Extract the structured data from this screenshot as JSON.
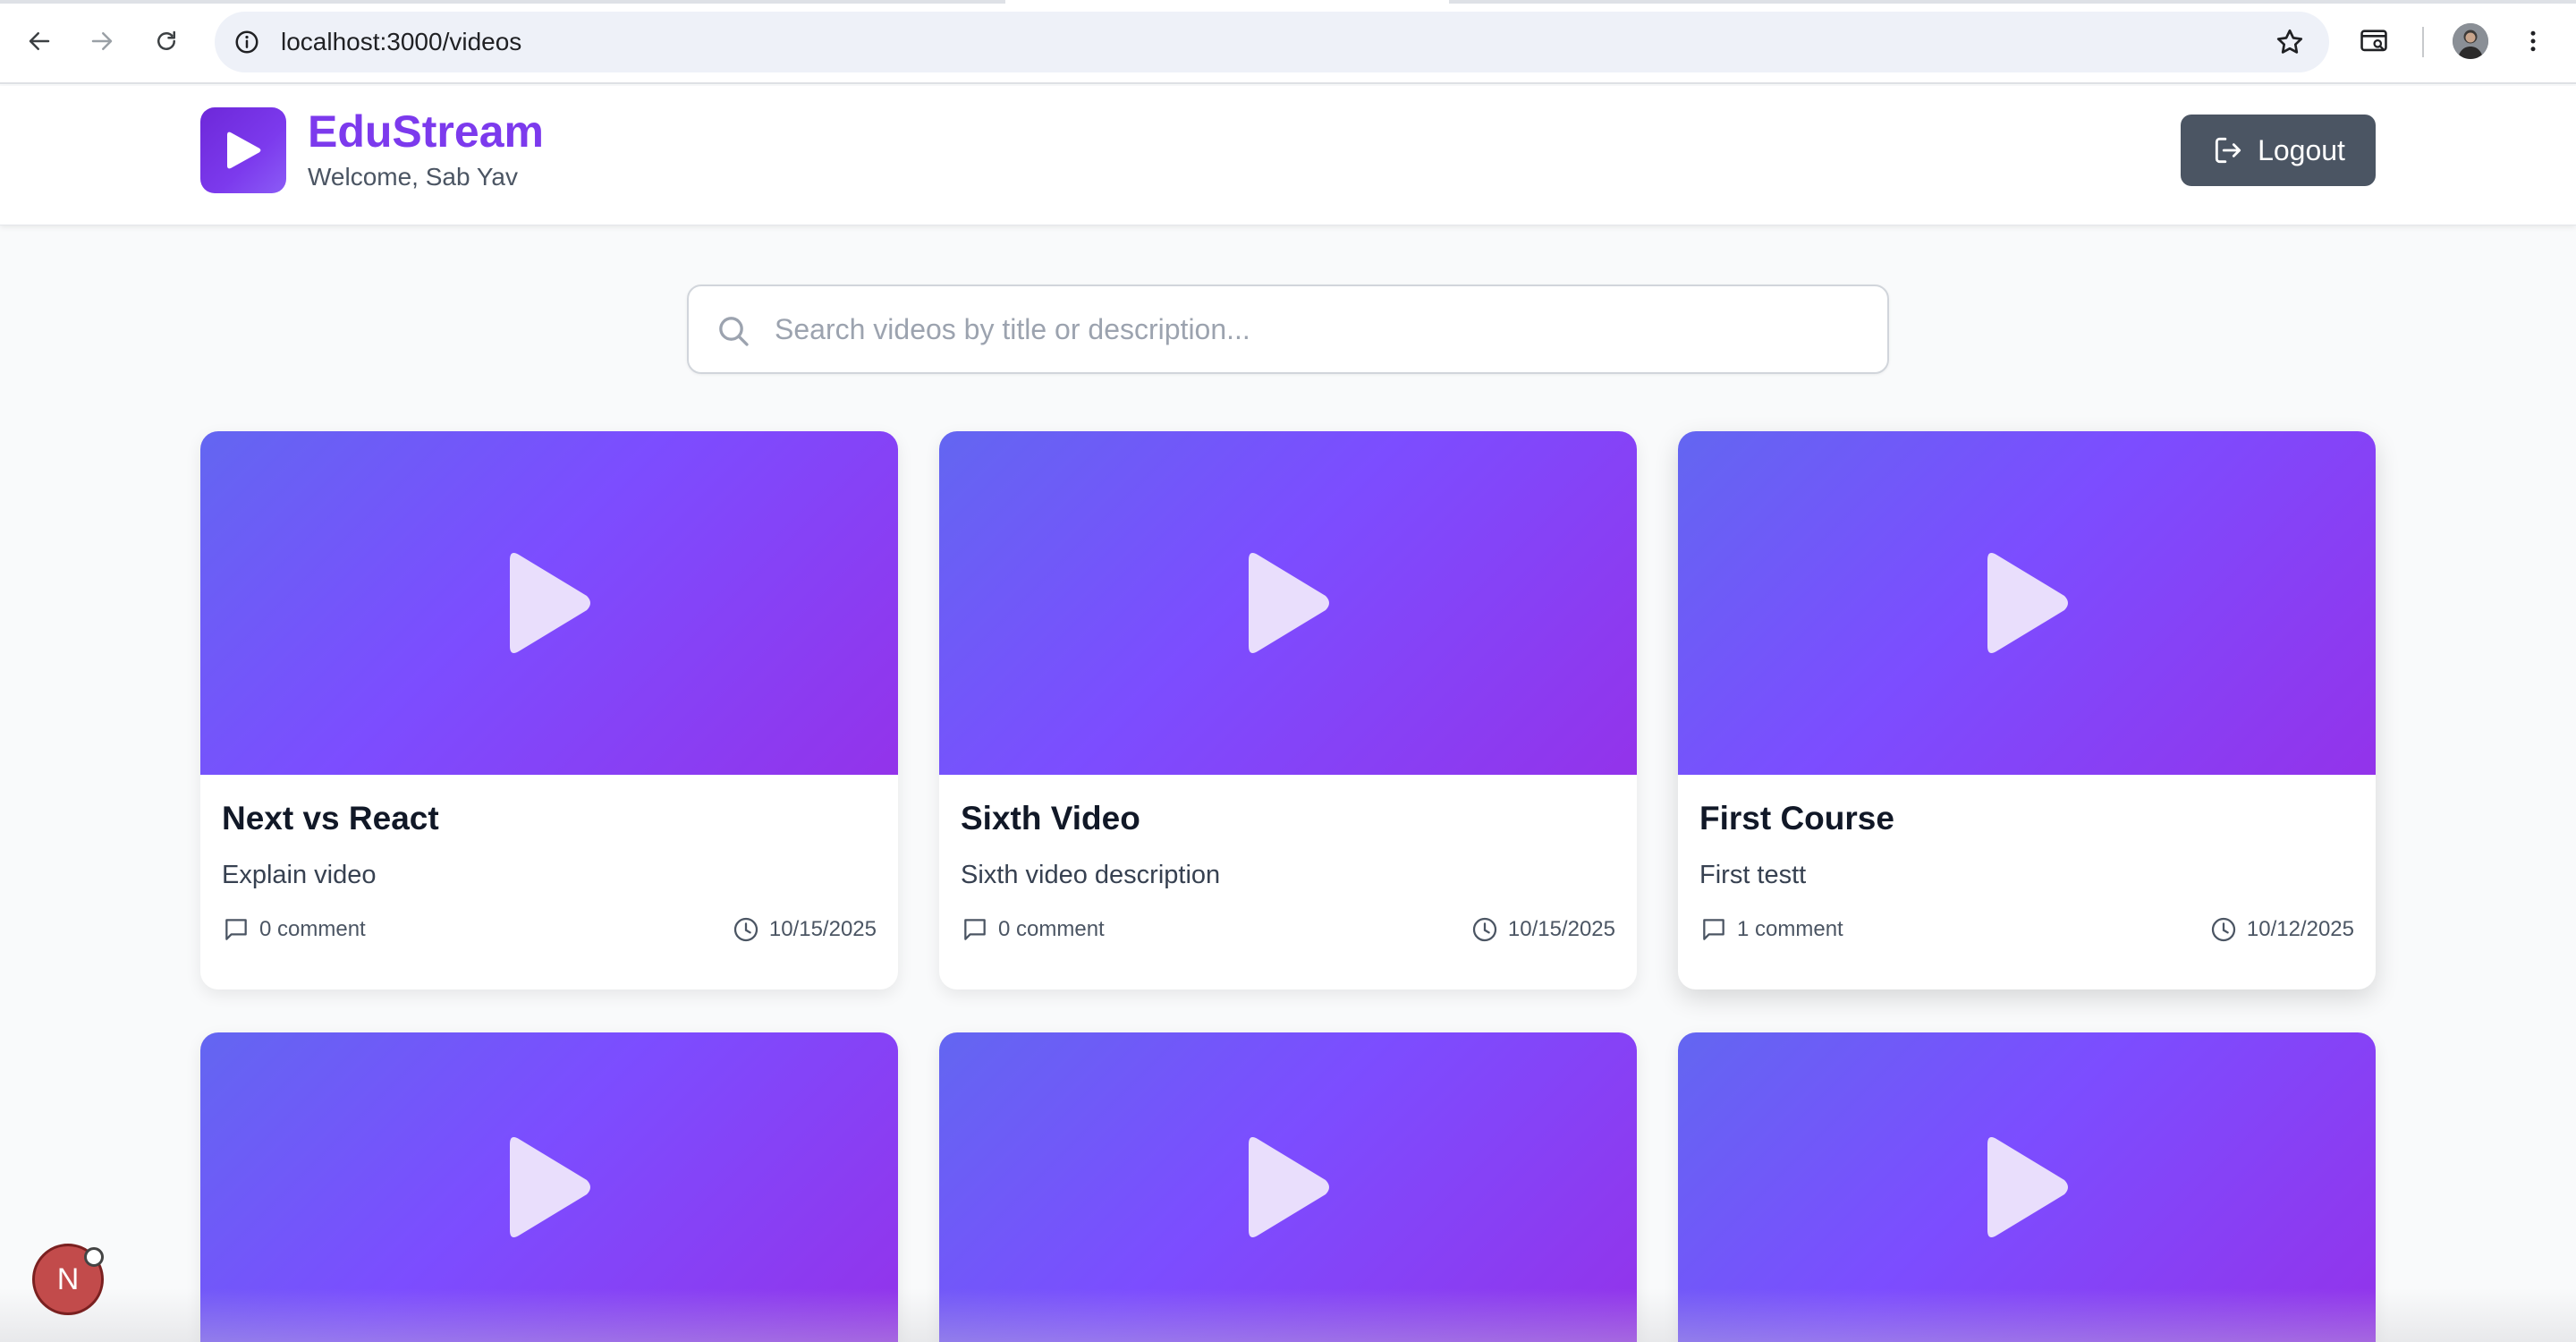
{
  "browser": {
    "url": "localhost:3000/videos",
    "icons": [
      "back-arrow-icon",
      "forward-arrow-icon",
      "reload-icon",
      "site-info-icon",
      "bookmark-star-icon",
      "tab-search-icon",
      "profile-avatar",
      "menu-dots-icon"
    ]
  },
  "header": {
    "brand": "EduStream",
    "welcome": "Welcome, Sab Yav",
    "logout_label": "Logout",
    "accent_color": "#7c3aed"
  },
  "search": {
    "placeholder": "Search videos by title or description..."
  },
  "videos": [
    {
      "title": "Next vs React",
      "description": "Explain video",
      "comments": "0 comment",
      "date": "10/15/2025"
    },
    {
      "title": "Sixth Video",
      "description": "Sixth video description",
      "comments": "0 comment",
      "date": "10/15/2025"
    },
    {
      "title": "First Course",
      "description": "First testt",
      "comments": "1 comment",
      "date": "10/12/2025"
    }
  ],
  "dev_badge": {
    "label": "N"
  },
  "colors": {
    "thumb_start": "#6366f1",
    "thumb_end": "#9333ea",
    "logout_bg": "#4b5563"
  }
}
